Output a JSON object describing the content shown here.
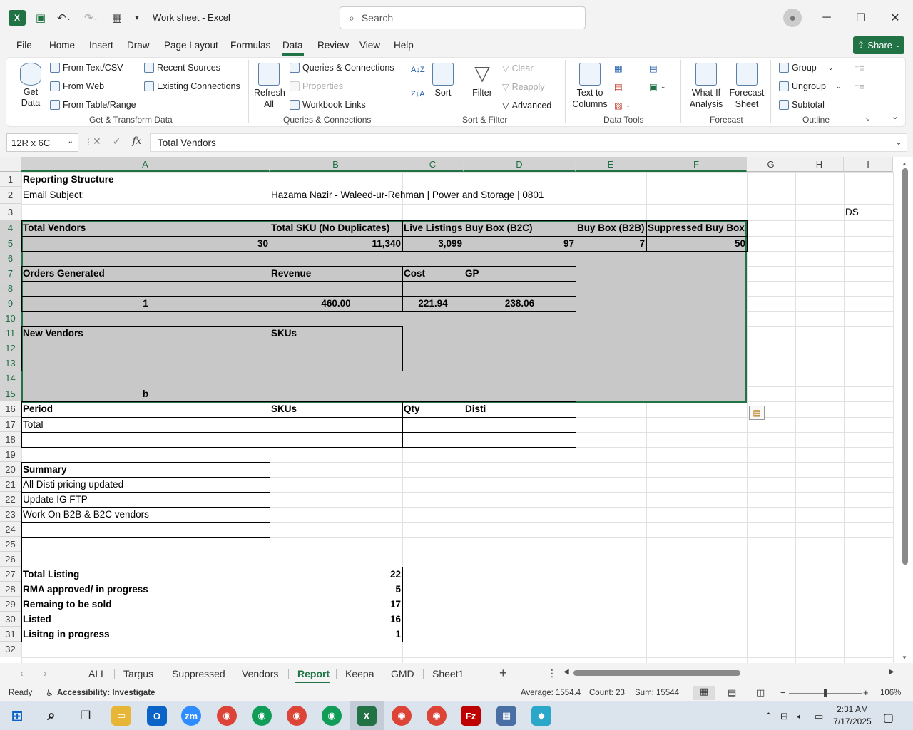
{
  "window": {
    "title": "Work sheet  -  Excel",
    "search_placeholder": "Search",
    "minimize": "─",
    "maximize": "☐",
    "close": "✕"
  },
  "menu": [
    "File",
    "Home",
    "Insert",
    "Draw",
    "Page Layout",
    "Formulas",
    "Data",
    "Review",
    "View",
    "Help"
  ],
  "active_menu": "Data",
  "share_label": "Share",
  "ribbon": {
    "get_data": "Get\nData",
    "from_text_csv": "From Text/CSV",
    "from_web": "From Web",
    "from_table_range": "From Table/Range",
    "recent_sources": "Recent Sources",
    "existing_connections": "Existing Connections",
    "group_get_transform": "Get & Transform Data",
    "refresh_all": "Refresh All",
    "queries_connections": "Queries & Connections",
    "properties": "Properties",
    "workbook_links": "Workbook Links",
    "group_queries": "Queries & Connections",
    "sort": "Sort",
    "filter": "Filter",
    "clear": "Clear",
    "reapply": "Reapply",
    "advanced": "Advanced",
    "group_sort_filter": "Sort & Filter",
    "text_to_columns": "Text to Columns",
    "group_data_tools": "Data Tools",
    "what_if": "What-If Analysis",
    "forecast_sheet": "Forecast Sheet",
    "group_forecast": "Forecast",
    "group": "Group",
    "ungroup": "Ungroup",
    "subtotal": "Subtotal",
    "group_outline": "Outline"
  },
  "formula_bar": {
    "name_box": "12R x 6C",
    "formula": "Total Vendors"
  },
  "columns": [
    "A",
    "B",
    "C",
    "D",
    "E",
    "F",
    "G",
    "H",
    "I"
  ],
  "rows": [
    "1",
    "2",
    "3",
    "4",
    "5",
    "6",
    "7",
    "8",
    "9",
    "10",
    "11",
    "12",
    "13",
    "14",
    "15",
    "16",
    "17",
    "18",
    "19",
    "20",
    "21",
    "22",
    "23",
    "24",
    "25",
    "26",
    "27",
    "28",
    "29",
    "30",
    "31",
    "32"
  ],
  "cells": {
    "A1": "Reporting Structure",
    "A2": "Email Subject:",
    "B2": "Hazama Nazir - Waleed-ur-Rehman | Power and Storage | 0801",
    "I3": "DS",
    "A4": "Total Vendors",
    "B4": "Total SKU (No Duplicates)",
    "C4": "Live Listings",
    "D4": "Buy Box (B2C)",
    "E4": "Buy Box (B2B)",
    "F4": "Suppressed Buy Box",
    "A5": "30",
    "B5": "11,340",
    "C5": "3,099",
    "D5": "97",
    "E5": "7",
    "F5": "50",
    "A7": "Orders Generated",
    "B7": "Revenue",
    "C7": "Cost",
    "D7": "GP",
    "A9": "1",
    "B9": "460.00",
    "C9": "221.94",
    "D9": "238.06",
    "A11": "New Vendors",
    "B11": "SKUs",
    "A15": "b",
    "A16": "Period",
    "B16": "SKUs",
    "C16": "Qty",
    "D16": "Disti",
    "A17": "Total",
    "A20": "Summary",
    "A21": "All Disti pricing updated",
    "A22": "Update IG FTP",
    "A23": "Work On B2B & B2C vendors",
    "A27": "Total Listing",
    "B27": "22",
    "A28": "RMA approved/ in progress",
    "B28": "5",
    "A29": "Remaing to be sold",
    "B29": "17",
    "A30": "Listed",
    "B30": "16",
    "A31": "Lisitng in progress",
    "B31": "1"
  },
  "sheet_tabs": [
    "ALL",
    "Targus",
    "Suppressed",
    "Vendors",
    "Report",
    "Keepa",
    "GMD",
    "Sheet1"
  ],
  "active_tab": "Report",
  "status": {
    "ready": "Ready",
    "accessibility": "Accessibility: Investigate",
    "average": "Average: 1554.4",
    "count": "Count: 23",
    "sum": "Sum: 15544",
    "zoom": "106%"
  },
  "taskbar": {
    "time": "2:31 AM",
    "date": "7/17/2025"
  },
  "colors": {
    "excel_green": "#217346",
    "selection_fill": "#c8c8c8"
  }
}
